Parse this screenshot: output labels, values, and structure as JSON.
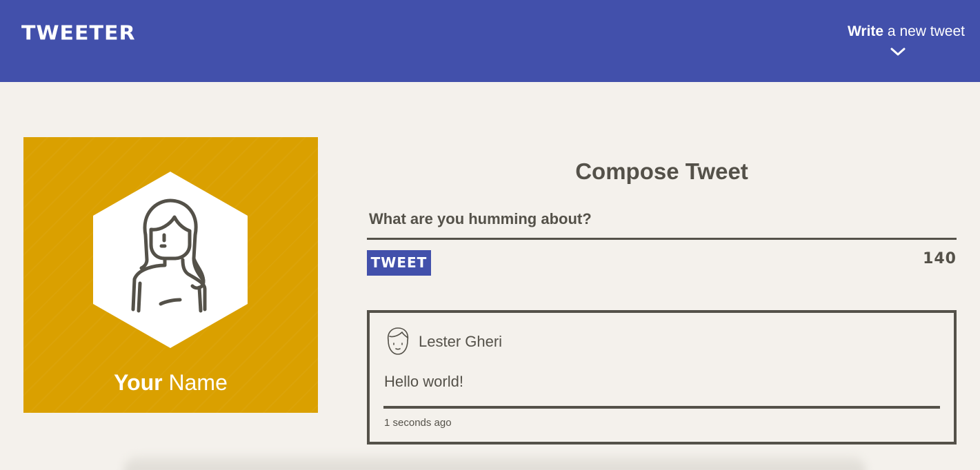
{
  "nav": {
    "brand": "TWEETER",
    "compose_toggle": {
      "bold": "Write",
      "rest": " a new tweet",
      "icon": "chevron-down-icon"
    }
  },
  "profile": {
    "name_bold": "Your",
    "name_rest": " Name",
    "avatar_icon": "woman-avatar-icon"
  },
  "compose": {
    "title": "Compose Tweet",
    "placeholder": "What are you humming about?",
    "button_label": "TWEET",
    "counter": "140"
  },
  "tweet": {
    "author": "Lester Gheri",
    "avatar_icon": "man-avatar-icon",
    "body": "Hello world!",
    "time": "1 seconds ago"
  },
  "colors": {
    "nav_bg": "#4250ab",
    "page_bg": "#f4f1ec",
    "profile_bg": "#daa000",
    "text": "#545149",
    "button_bg": "#4250ab"
  }
}
